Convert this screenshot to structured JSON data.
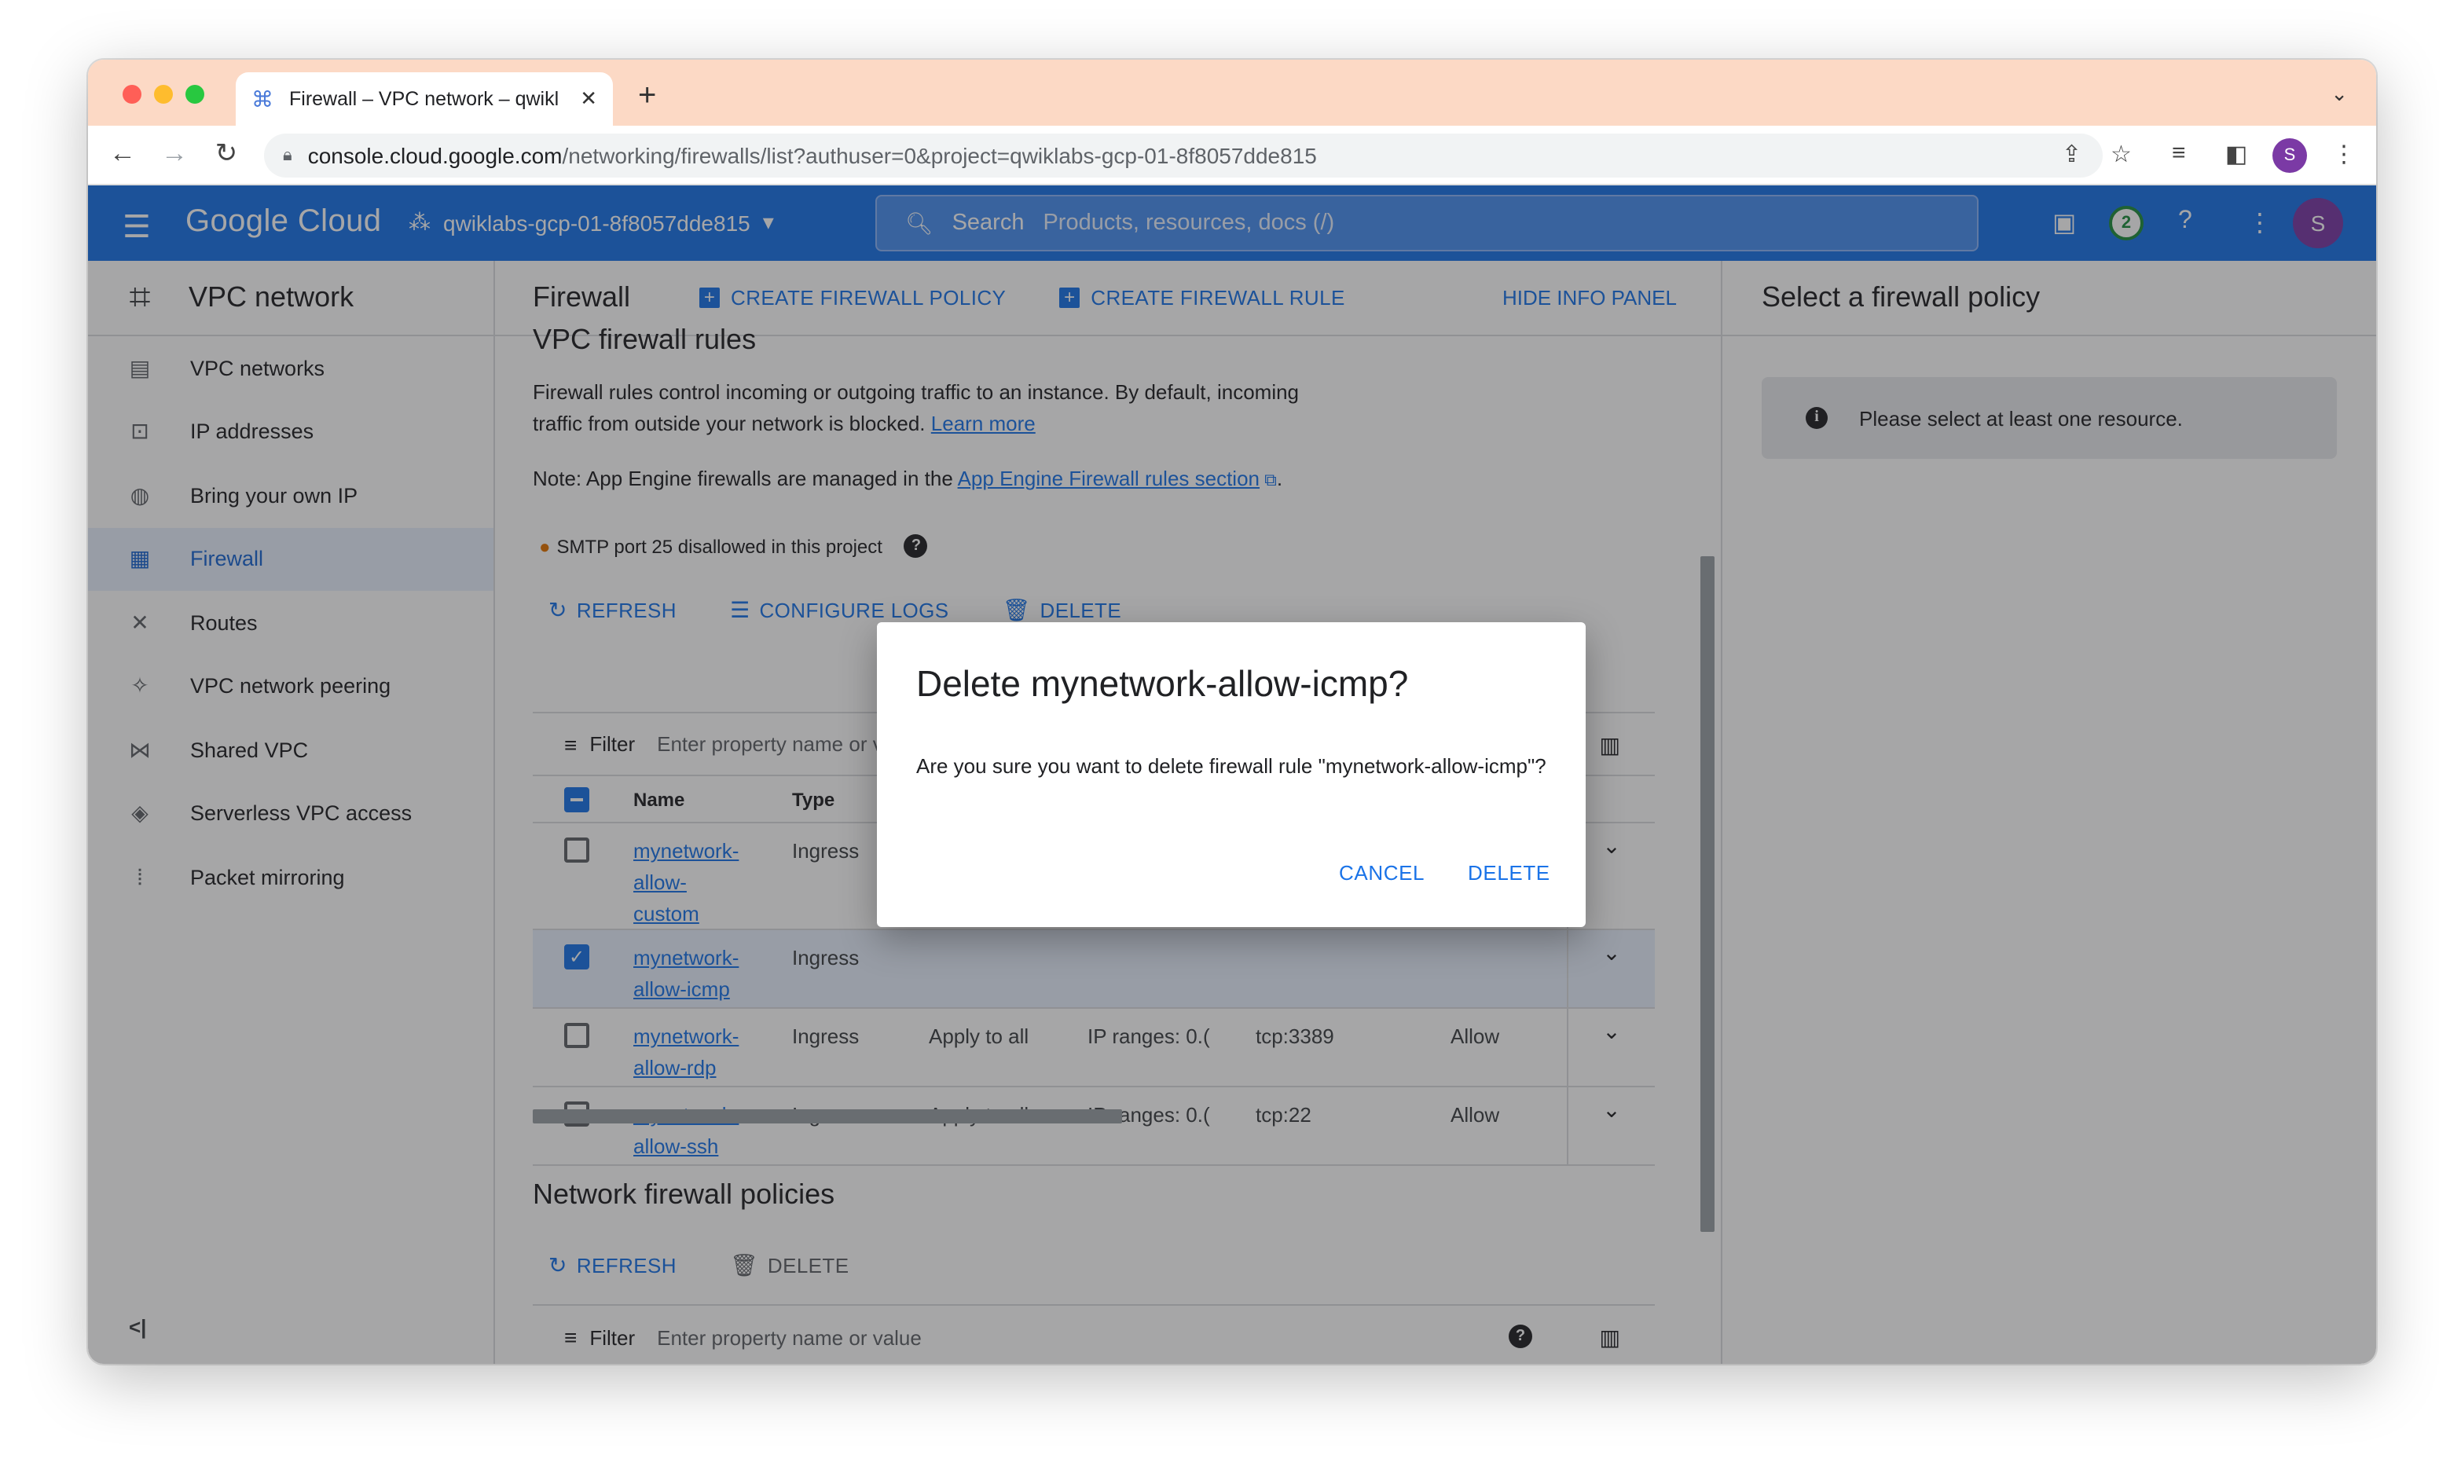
{
  "browser": {
    "tab_title": "Firewall – VPC network – qwikl",
    "url_domain": "console.cloud.google.com",
    "url_path": "/networking/firewalls/list?authuser=0&project=qwiklabs-gcp-01-8f8057dde815",
    "profile_initial": "S",
    "traffic_lights": [
      "#ff5f57",
      "#febc2e",
      "#28c840"
    ]
  },
  "header": {
    "logo": "Google Cloud",
    "project": "qwiklabs-gcp-01-8f8057dde815",
    "search_label": "Search",
    "search_placeholder": "Products, resources, docs (/)",
    "notifications": "2",
    "avatar_initial": "S"
  },
  "sidebar": {
    "title": "VPC network",
    "items": [
      {
        "label": "VPC networks",
        "icon": "vpc-networks-icon"
      },
      {
        "label": "IP addresses",
        "icon": "ip-addresses-icon"
      },
      {
        "label": "Bring your own IP",
        "icon": "globe-icon"
      },
      {
        "label": "Firewall",
        "icon": "firewall-icon"
      },
      {
        "label": "Routes",
        "icon": "routes-icon"
      },
      {
        "label": "VPC network peering",
        "icon": "peering-icon"
      },
      {
        "label": "Shared VPC",
        "icon": "shared-vpc-icon"
      },
      {
        "label": "Serverless VPC access",
        "icon": "serverless-icon"
      },
      {
        "label": "Packet mirroring",
        "icon": "packet-mirroring-icon"
      }
    ],
    "active_item": "Firewall",
    "collapse_label": "<|"
  },
  "main": {
    "title": "Firewall",
    "create_policy": "CREATE FIREWALL POLICY",
    "create_rule": "CREATE FIREWALL RULE",
    "hide_info": "HIDE INFO PANEL",
    "section_title": "VPC firewall rules",
    "description": "Firewall rules control incoming or outgoing traffic to an instance. By default, incoming traffic from outside your network is blocked.",
    "learn_more": "Learn more",
    "note_prefix": "Note: App Engine firewalls are managed in the",
    "note_link": "App Engine Firewall rules section",
    "note_suffix": ".",
    "smtp": "SMTP port 25 disallowed in this project",
    "toolbar": {
      "refresh": "REFRESH",
      "configure_logs": "CONFIGURE LOGS",
      "delete": "DELETE"
    },
    "filter_label": "Filter",
    "filter_placeholder": "Enter property name or value",
    "columns": {
      "name": "Name",
      "type": "Type"
    },
    "rows": [
      {
        "name": "mynetwork-allow-custom",
        "name_lines": [
          "mynetwork-",
          "allow-",
          "custom"
        ],
        "type": "Ingress",
        "targets": "",
        "filters": "",
        "protocols": "",
        "action": "",
        "checked": false
      },
      {
        "name": "mynetwork-allow-icmp",
        "name_lines": [
          "mynetwork-",
          "allow-icmp"
        ],
        "type": "Ingress",
        "targets": "",
        "filters": "",
        "protocols": "",
        "action": "",
        "checked": true
      },
      {
        "name": "mynetwork-allow-rdp",
        "name_lines": [
          "mynetwork-",
          "allow-rdp"
        ],
        "type": "Ingress",
        "targets": "Apply to all",
        "filters": "IP ranges: 0.(",
        "protocols": "tcp:3389",
        "action": "Allow",
        "checked": false
      },
      {
        "name": "mynetwork-allow-ssh",
        "name_lines": [
          "mynetwork-",
          "allow-ssh"
        ],
        "type": "Ingress",
        "targets": "Apply to all",
        "filters": "IP ranges: 0.(",
        "protocols": "tcp:22",
        "action": "Allow",
        "checked": false
      }
    ],
    "network_policies_title": "Network firewall policies",
    "np_toolbar": {
      "refresh": "REFRESH",
      "delete": "DELETE"
    }
  },
  "info_panel": {
    "title": "Select a firewall policy",
    "message": "Please select at least one resource."
  },
  "dialog": {
    "title": "Delete mynetwork-allow-icmp?",
    "message": "Are you sure you want to delete firewall rule \"mynetwork-allow-icmp\"?",
    "cancel": "CANCEL",
    "confirm": "DELETE"
  }
}
